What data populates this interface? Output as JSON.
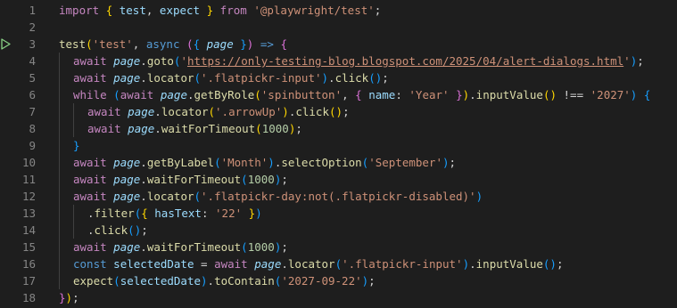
{
  "editor": {
    "run_line": 3,
    "lines": [
      {
        "num": "1",
        "indent": 0,
        "tokens": [
          {
            "t": "kw",
            "v": "import"
          },
          {
            "t": "pu",
            "v": " "
          },
          {
            "t": "b1",
            "v": "{"
          },
          {
            "t": "va",
            "v": " test"
          },
          {
            "t": "pu",
            "v": ", "
          },
          {
            "t": "va",
            "v": "expect"
          },
          {
            "t": "pu",
            "v": " "
          },
          {
            "t": "b1",
            "v": "}"
          },
          {
            "t": "pu",
            "v": " "
          },
          {
            "t": "kw",
            "v": "from"
          },
          {
            "t": "pu",
            "v": " "
          },
          {
            "t": "st",
            "v": "'@playwright/test'"
          },
          {
            "t": "pu",
            "v": ";"
          }
        ]
      },
      {
        "num": "2",
        "indent": 0,
        "tokens": []
      },
      {
        "num": "3",
        "indent": 0,
        "tokens": [
          {
            "t": "fn",
            "v": "test"
          },
          {
            "t": "b1",
            "v": "("
          },
          {
            "t": "st",
            "v": "'test'"
          },
          {
            "t": "pu",
            "v": ", "
          },
          {
            "t": "cn",
            "v": "async"
          },
          {
            "t": "pu",
            "v": " "
          },
          {
            "t": "b2",
            "v": "("
          },
          {
            "t": "b3",
            "v": "{"
          },
          {
            "t": "pu",
            "v": " "
          },
          {
            "t": "pr",
            "v": "page"
          },
          {
            "t": "pu",
            "v": " "
          },
          {
            "t": "b3",
            "v": "}"
          },
          {
            "t": "b2",
            "v": ")"
          },
          {
            "t": "pu",
            "v": " "
          },
          {
            "t": "cn",
            "v": "=>"
          },
          {
            "t": "pu",
            "v": " "
          },
          {
            "t": "b2",
            "v": "{"
          }
        ]
      },
      {
        "num": "4",
        "indent": 1,
        "tokens": [
          {
            "t": "kw",
            "v": "await"
          },
          {
            "t": "pu",
            "v": " "
          },
          {
            "t": "pr",
            "v": "page"
          },
          {
            "t": "pu",
            "v": "."
          },
          {
            "t": "fn",
            "v": "goto"
          },
          {
            "t": "b3",
            "v": "("
          },
          {
            "t": "st",
            "v": "'"
          },
          {
            "t": "url",
            "v": "https://only-testing-blog.blogspot.com/2025/04/alert-dialogs.html"
          },
          {
            "t": "st",
            "v": "'"
          },
          {
            "t": "b3",
            "v": ")"
          },
          {
            "t": "pu",
            "v": ";"
          }
        ]
      },
      {
        "num": "5",
        "indent": 1,
        "tokens": [
          {
            "t": "kw",
            "v": "await"
          },
          {
            "t": "pu",
            "v": " "
          },
          {
            "t": "pr",
            "v": "page"
          },
          {
            "t": "pu",
            "v": "."
          },
          {
            "t": "fn",
            "v": "locator"
          },
          {
            "t": "b3",
            "v": "("
          },
          {
            "t": "st",
            "v": "'.flatpickr-input'"
          },
          {
            "t": "b3",
            "v": ")"
          },
          {
            "t": "pu",
            "v": "."
          },
          {
            "t": "fn",
            "v": "click"
          },
          {
            "t": "b3",
            "v": "()"
          },
          {
            "t": "pu",
            "v": ";"
          }
        ]
      },
      {
        "num": "6",
        "indent": 1,
        "tokens": [
          {
            "t": "kw",
            "v": "while"
          },
          {
            "t": "pu",
            "v": " "
          },
          {
            "t": "b3",
            "v": "("
          },
          {
            "t": "kw",
            "v": "await"
          },
          {
            "t": "pu",
            "v": " "
          },
          {
            "t": "pr",
            "v": "page"
          },
          {
            "t": "pu",
            "v": "."
          },
          {
            "t": "fn",
            "v": "getByRole"
          },
          {
            "t": "b1",
            "v": "("
          },
          {
            "t": "st",
            "v": "'spinbutton'"
          },
          {
            "t": "pu",
            "v": ", "
          },
          {
            "t": "b2",
            "v": "{"
          },
          {
            "t": "pu",
            "v": " "
          },
          {
            "t": "va",
            "v": "name"
          },
          {
            "t": "pu",
            "v": ": "
          },
          {
            "t": "st",
            "v": "'Year'"
          },
          {
            "t": "pu",
            "v": " "
          },
          {
            "t": "b2",
            "v": "}"
          },
          {
            "t": "b1",
            "v": ")"
          },
          {
            "t": "pu",
            "v": "."
          },
          {
            "t": "fn",
            "v": "inputValue"
          },
          {
            "t": "b1",
            "v": "()"
          },
          {
            "t": "pu",
            "v": " "
          },
          {
            "t": "op",
            "v": "!=="
          },
          {
            "t": "pu",
            "v": " "
          },
          {
            "t": "st",
            "v": "'2027'"
          },
          {
            "t": "b3",
            "v": ")"
          },
          {
            "t": "pu",
            "v": " "
          },
          {
            "t": "b3",
            "v": "{"
          }
        ]
      },
      {
        "num": "7",
        "indent": 2,
        "tokens": [
          {
            "t": "kw",
            "v": "await"
          },
          {
            "t": "pu",
            "v": " "
          },
          {
            "t": "pr",
            "v": "page"
          },
          {
            "t": "pu",
            "v": "."
          },
          {
            "t": "fn",
            "v": "locator"
          },
          {
            "t": "b1",
            "v": "("
          },
          {
            "t": "st",
            "v": "'.arrowUp'"
          },
          {
            "t": "b1",
            "v": ")"
          },
          {
            "t": "pu",
            "v": "."
          },
          {
            "t": "fn",
            "v": "click"
          },
          {
            "t": "b1",
            "v": "()"
          },
          {
            "t": "pu",
            "v": ";"
          }
        ]
      },
      {
        "num": "8",
        "indent": 2,
        "tokens": [
          {
            "t": "kw",
            "v": "await"
          },
          {
            "t": "pu",
            "v": " "
          },
          {
            "t": "pr",
            "v": "page"
          },
          {
            "t": "pu",
            "v": "."
          },
          {
            "t": "fn",
            "v": "waitForTimeout"
          },
          {
            "t": "b1",
            "v": "("
          },
          {
            "t": "nu",
            "v": "1000"
          },
          {
            "t": "b1",
            "v": ")"
          },
          {
            "t": "pu",
            "v": ";"
          }
        ]
      },
      {
        "num": "9",
        "indent": 1,
        "tokens": [
          {
            "t": "b3",
            "v": "}"
          }
        ]
      },
      {
        "num": "10",
        "indent": 1,
        "tokens": [
          {
            "t": "kw",
            "v": "await"
          },
          {
            "t": "pu",
            "v": " "
          },
          {
            "t": "pr",
            "v": "page"
          },
          {
            "t": "pu",
            "v": "."
          },
          {
            "t": "fn",
            "v": "getByLabel"
          },
          {
            "t": "b3",
            "v": "("
          },
          {
            "t": "st",
            "v": "'Month'"
          },
          {
            "t": "b3",
            "v": ")"
          },
          {
            "t": "pu",
            "v": "."
          },
          {
            "t": "fn",
            "v": "selectOption"
          },
          {
            "t": "b3",
            "v": "("
          },
          {
            "t": "st",
            "v": "'September'"
          },
          {
            "t": "b3",
            "v": ")"
          },
          {
            "t": "pu",
            "v": ";"
          }
        ]
      },
      {
        "num": "11",
        "indent": 1,
        "tokens": [
          {
            "t": "kw",
            "v": "await"
          },
          {
            "t": "pu",
            "v": " "
          },
          {
            "t": "pr",
            "v": "page"
          },
          {
            "t": "pu",
            "v": "."
          },
          {
            "t": "fn",
            "v": "waitForTimeout"
          },
          {
            "t": "b3",
            "v": "("
          },
          {
            "t": "nu",
            "v": "1000"
          },
          {
            "t": "b3",
            "v": ")"
          },
          {
            "t": "pu",
            "v": ";"
          }
        ]
      },
      {
        "num": "12",
        "indent": 1,
        "tokens": [
          {
            "t": "kw",
            "v": "await"
          },
          {
            "t": "pu",
            "v": " "
          },
          {
            "t": "pr",
            "v": "page"
          },
          {
            "t": "pu",
            "v": "."
          },
          {
            "t": "fn",
            "v": "locator"
          },
          {
            "t": "b3",
            "v": "("
          },
          {
            "t": "st",
            "v": "'.flatpickr-day:not(.flatpickr-disabled)'"
          },
          {
            "t": "b3",
            "v": ")"
          }
        ]
      },
      {
        "num": "13",
        "indent": 2,
        "tokens": [
          {
            "t": "pu",
            "v": "."
          },
          {
            "t": "fn",
            "v": "filter"
          },
          {
            "t": "b3",
            "v": "("
          },
          {
            "t": "b1",
            "v": "{"
          },
          {
            "t": "pu",
            "v": " "
          },
          {
            "t": "va",
            "v": "hasText"
          },
          {
            "t": "pu",
            "v": ": "
          },
          {
            "t": "st",
            "v": "'22'"
          },
          {
            "t": "pu",
            "v": " "
          },
          {
            "t": "b1",
            "v": "}"
          },
          {
            "t": "b3",
            "v": ")"
          }
        ]
      },
      {
        "num": "14",
        "indent": 2,
        "tokens": [
          {
            "t": "pu",
            "v": "."
          },
          {
            "t": "fn",
            "v": "click"
          },
          {
            "t": "b3",
            "v": "()"
          },
          {
            "t": "pu",
            "v": ";"
          }
        ]
      },
      {
        "num": "15",
        "indent": 1,
        "tokens": [
          {
            "t": "kw",
            "v": "await"
          },
          {
            "t": "pu",
            "v": " "
          },
          {
            "t": "pr",
            "v": "page"
          },
          {
            "t": "pu",
            "v": "."
          },
          {
            "t": "fn",
            "v": "waitForTimeout"
          },
          {
            "t": "b3",
            "v": "("
          },
          {
            "t": "nu",
            "v": "1000"
          },
          {
            "t": "b3",
            "v": ")"
          },
          {
            "t": "pu",
            "v": ";"
          }
        ]
      },
      {
        "num": "16",
        "indent": 1,
        "tokens": [
          {
            "t": "cn",
            "v": "const"
          },
          {
            "t": "pu",
            "v": " "
          },
          {
            "t": "va",
            "v": "selectedDate"
          },
          {
            "t": "pu",
            "v": " "
          },
          {
            "t": "op",
            "v": "="
          },
          {
            "t": "pu",
            "v": " "
          },
          {
            "t": "kw",
            "v": "await"
          },
          {
            "t": "pu",
            "v": " "
          },
          {
            "t": "pr",
            "v": "page"
          },
          {
            "t": "pu",
            "v": "."
          },
          {
            "t": "fn",
            "v": "locator"
          },
          {
            "t": "b3",
            "v": "("
          },
          {
            "t": "st",
            "v": "'.flatpickr-input'"
          },
          {
            "t": "b3",
            "v": ")"
          },
          {
            "t": "pu",
            "v": "."
          },
          {
            "t": "fn",
            "v": "inputValue"
          },
          {
            "t": "b3",
            "v": "()"
          },
          {
            "t": "pu",
            "v": ";"
          }
        ]
      },
      {
        "num": "17",
        "indent": 1,
        "tokens": [
          {
            "t": "fn",
            "v": "expect"
          },
          {
            "t": "b3",
            "v": "("
          },
          {
            "t": "va",
            "v": "selectedDate"
          },
          {
            "t": "b3",
            "v": ")"
          },
          {
            "t": "pu",
            "v": "."
          },
          {
            "t": "fn",
            "v": "toContain"
          },
          {
            "t": "b3",
            "v": "("
          },
          {
            "t": "st",
            "v": "'2027-09-22'"
          },
          {
            "t": "b3",
            "v": ")"
          },
          {
            "t": "pu",
            "v": ";"
          }
        ]
      },
      {
        "num": "18",
        "indent": 0,
        "tokens": [
          {
            "t": "b2",
            "v": "}"
          },
          {
            "t": "b1",
            "v": ")"
          },
          {
            "t": "pu",
            "v": ";"
          }
        ]
      }
    ]
  }
}
